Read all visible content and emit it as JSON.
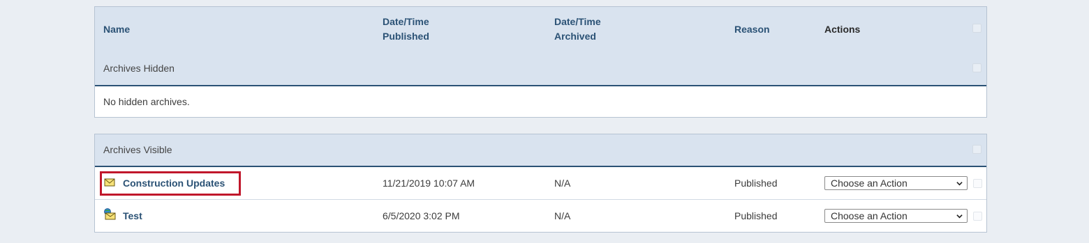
{
  "columns": {
    "name": "Name",
    "published_line1": "Date/Time",
    "published_line2": "Published",
    "archived_line1": "Date/Time",
    "archived_line2": "Archived",
    "reason": "Reason",
    "actions": "Actions"
  },
  "hidden": {
    "title": "Archives Hidden",
    "empty_message": "No hidden archives."
  },
  "visible": {
    "title": "Archives Visible",
    "rows": [
      {
        "icon": "envelope-icon",
        "name": "Construction Updates",
        "published": "11/21/2019 10:07 AM",
        "archived": "N/A",
        "reason": "Published",
        "action": "Choose an Action",
        "highlighted": true
      },
      {
        "icon": "envelope-web-icon",
        "name": "Test",
        "published": "6/5/2020 3:02 PM",
        "archived": "N/A",
        "reason": "Published",
        "action": "Choose an Action",
        "highlighted": false
      }
    ]
  },
  "colors": {
    "header_bg": "#d9e3ef",
    "link": "#2b5275",
    "highlight": "#c0172b"
  }
}
